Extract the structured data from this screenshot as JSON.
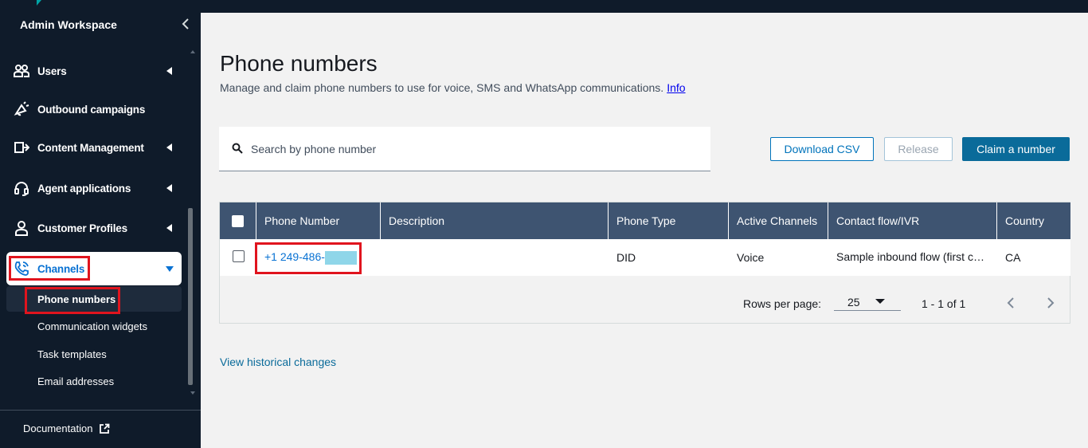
{
  "sidebar": {
    "workspace_title": "Admin Workspace",
    "items": [
      {
        "label": "Users"
      },
      {
        "label": "Outbound campaigns"
      },
      {
        "label": "Content Management"
      },
      {
        "label": "Agent applications"
      },
      {
        "label": "Customer Profiles"
      },
      {
        "label": "Channels"
      }
    ],
    "channels_subitems": [
      {
        "label": "Phone numbers"
      },
      {
        "label": "Communication widgets"
      },
      {
        "label": "Task templates"
      },
      {
        "label": "Email addresses"
      }
    ],
    "documentation_label": "Documentation"
  },
  "page": {
    "title": "Phone numbers",
    "description": "Manage and claim phone numbers to use for voice, SMS and WhatsApp communications.",
    "info_link": "Info"
  },
  "search": {
    "placeholder": "Search by phone number"
  },
  "actions": {
    "download_csv": "Download CSV",
    "release": "Release",
    "claim": "Claim a number"
  },
  "table": {
    "columns": [
      "Phone Number",
      "Description",
      "Phone Type",
      "Active Channels",
      "Contact flow/IVR",
      "Country"
    ],
    "rows": [
      {
        "phone_number": "+1 249-486-",
        "description": "",
        "phone_type": "DID",
        "active_channels": "Voice",
        "contact_flow": "Sample inbound flow (first contact experience)",
        "country": "CA"
      }
    ]
  },
  "pagination": {
    "rows_per_page_label": "Rows per page:",
    "rows_per_page": "25",
    "range": "1 - 1  of 1"
  },
  "footer": {
    "history_link": "View historical changes"
  },
  "colors": {
    "sidebar_bg": "#0f1b2a",
    "table_header_bg": "#3e5471",
    "primary_button": "#0a6b9a",
    "highlight": "#e0141e",
    "link": "#0972d3"
  }
}
